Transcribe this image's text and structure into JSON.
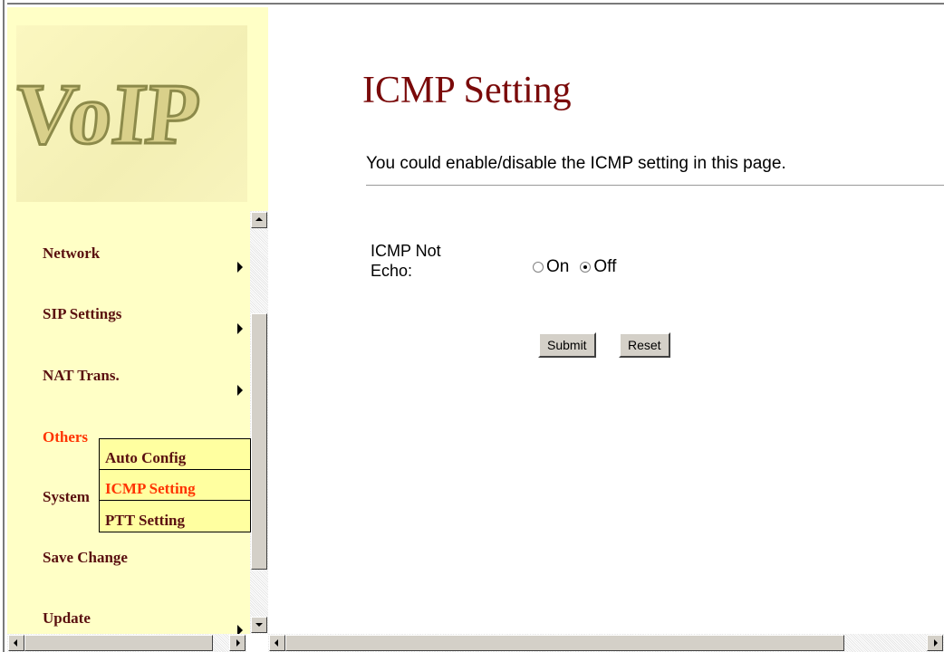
{
  "logo": {
    "text": "VoIP"
  },
  "menu": {
    "items": [
      {
        "label": "Network",
        "has_submenu": true
      },
      {
        "label": "SIP Settings",
        "has_submenu": true
      },
      {
        "label": "NAT Trans.",
        "has_submenu": true
      },
      {
        "label": "Others",
        "active": true
      },
      {
        "label": "System"
      },
      {
        "label": "Save Change"
      },
      {
        "label": "Update",
        "has_submenu": true
      }
    ],
    "submenu": [
      {
        "label": "Auto Config"
      },
      {
        "label": "ICMP Setting",
        "active": true
      },
      {
        "label": "PTT Setting"
      }
    ]
  },
  "page": {
    "title": "ICMP Setting",
    "description": "You could enable/disable the ICMP setting in this page.",
    "field_label": "ICMP Not Echo:",
    "options": [
      {
        "label": "On",
        "checked": false
      },
      {
        "label": "Off",
        "checked": true
      }
    ],
    "submit_label": "Submit",
    "reset_label": "Reset"
  },
  "colors": {
    "sidebar_bg": "#ffffc6",
    "menu_text": "#5a1010",
    "active_text": "#ff3300",
    "title": "#7a0a0a"
  }
}
